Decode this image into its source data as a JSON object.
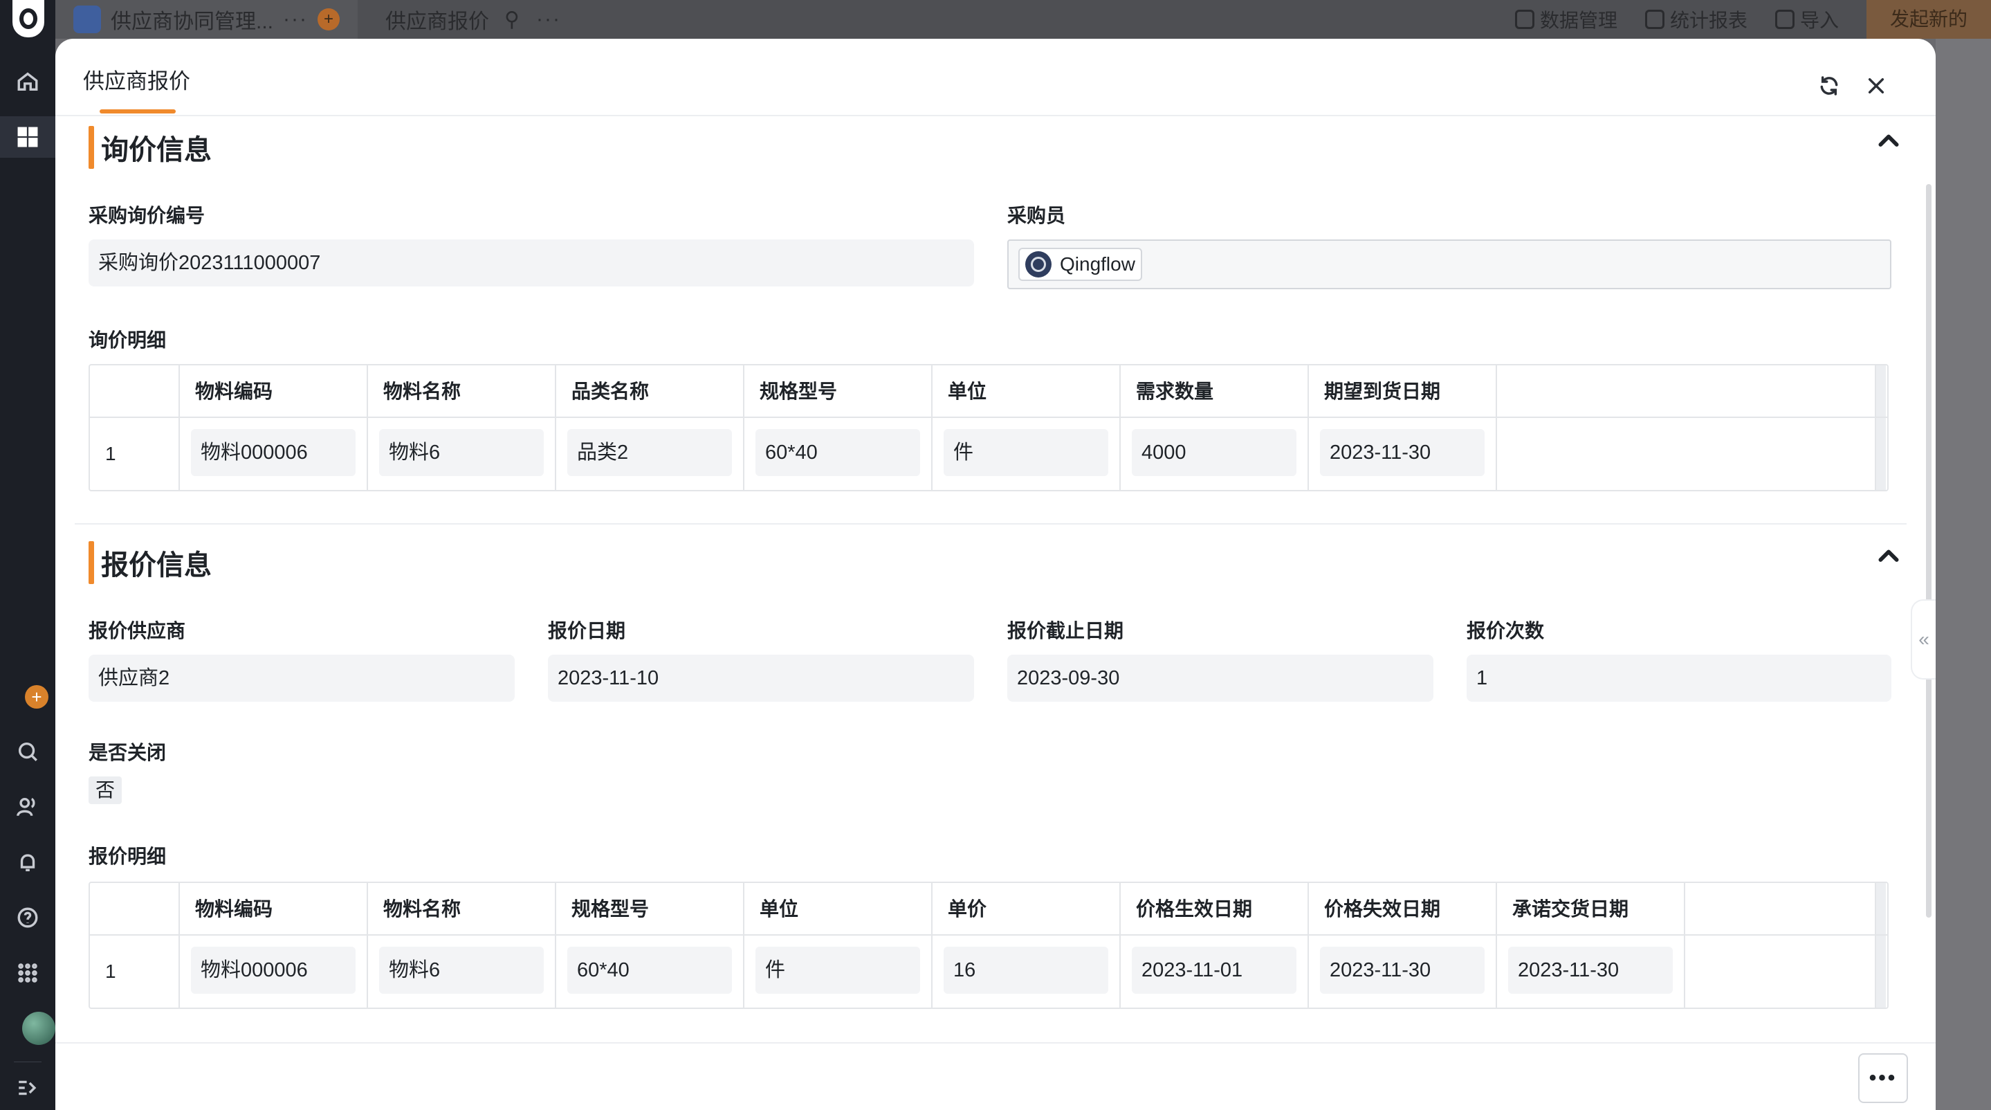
{
  "topbar": {
    "app_name": "供应商协同管理...",
    "page_name": "供应商报价",
    "data_manage": "数据管理",
    "reports": "统计报表",
    "import": "导入",
    "start_new": "发起新的"
  },
  "modal": {
    "title": "供应商报价"
  },
  "inquiry_section": {
    "title": "询价信息",
    "inquiry_no_label": "采购询价编号",
    "inquiry_no_value": "采购询价2023111000007",
    "buyer_label": "采购员",
    "buyer_value": "Qingflow",
    "details_label": "询价明细",
    "columns": [
      "物料编码",
      "物料名称",
      "品类名称",
      "规格型号",
      "单位",
      "需求数量",
      "期望到货日期"
    ],
    "rows": [
      {
        "index": "1",
        "cells": [
          "物料000006",
          "物料6",
          "品类2",
          "60*40",
          "件",
          "4000",
          "2023-11-30"
        ]
      }
    ]
  },
  "quote_section": {
    "title": "报价信息",
    "supplier_label": "报价供应商",
    "supplier_value": "供应商2",
    "quote_date_label": "报价日期",
    "quote_date_value": "2023-11-10",
    "deadline_label": "报价截止日期",
    "deadline_value": "2023-09-30",
    "count_label": "报价次数",
    "count_value": "1",
    "closed_label": "是否关闭",
    "closed_value": "否",
    "details_label": "报价明细",
    "columns": [
      "物料编码",
      "物料名称",
      "规格型号",
      "单位",
      "单价",
      "价格生效日期",
      "价格失效日期",
      "承诺交货日期"
    ],
    "rows": [
      {
        "index": "1",
        "cells": [
          "物料000006",
          "物料6",
          "60*40",
          "件",
          "16",
          "2023-11-01",
          "2023-11-30",
          "2023-11-30"
        ]
      }
    ]
  },
  "footer": {
    "more_label": "•••"
  },
  "side_handle": "«",
  "colors": {
    "accent": "#f08a2c",
    "field_bg": "#f3f4f6"
  }
}
